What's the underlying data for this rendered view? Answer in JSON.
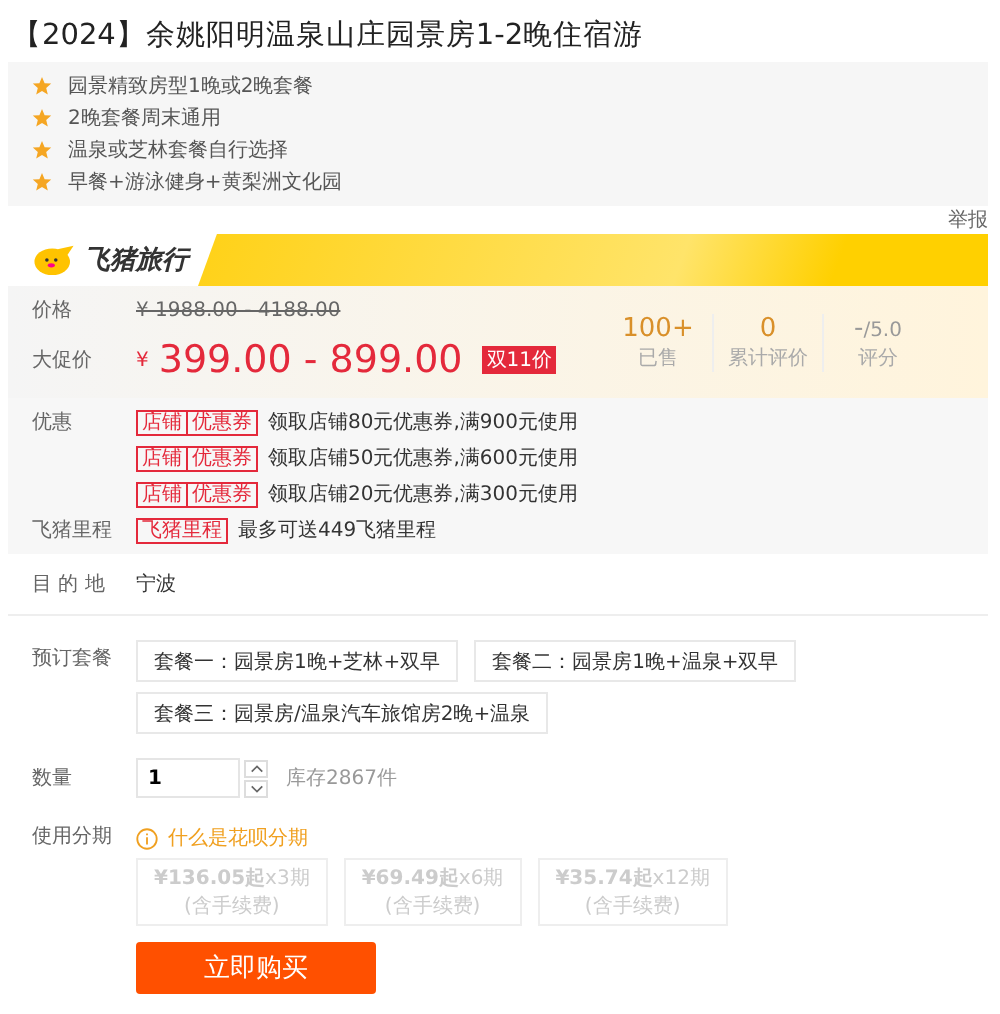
{
  "title": "【2024】余姚阳明温泉山庄园景房1-2晚住宿游",
  "features": [
    "园景精致房型1晚或2晚套餐",
    "2晚套餐周末通用",
    "温泉或芝林套餐自行选择",
    "早餐+游泳健身+黄梨洲文化园"
  ],
  "report_link": "举报",
  "brand": {
    "name": "飞猪旅行"
  },
  "price": {
    "label": "价格",
    "original": "¥ 1988.00 - 4188.00",
    "promo_label": "大促价",
    "currency": "¥",
    "promo": "399.00 - 899.00",
    "badge": "双11价"
  },
  "stats": [
    {
      "value": "100+",
      "label": "已售"
    },
    {
      "value": "0",
      "label": "累计评价"
    },
    {
      "value": "-",
      "suffix": "/5.0",
      "label": "评分"
    }
  ],
  "coupons": {
    "label": "优惠",
    "items": [
      {
        "tag": [
          "店铺",
          "优惠券"
        ],
        "text": "领取店铺80元优惠券,满900元使用"
      },
      {
        "tag": [
          "店铺",
          "优惠券"
        ],
        "text": "领取店铺50元优惠券,满600元使用"
      },
      {
        "tag": [
          "店铺",
          "优惠券"
        ],
        "text": "领取店铺20元优惠券,满300元使用"
      }
    ]
  },
  "mileage": {
    "label": "飞猪里程",
    "tag": "飞猪里程",
    "text": "最多可送449飞猪里程"
  },
  "destination": {
    "label": "目 的 地",
    "value": "宁波"
  },
  "packages": {
    "label": "预订套餐",
    "options": [
      {
        "text": "套餐一：园景房1晚+芝林+双早",
        "selected": false
      },
      {
        "text": "套餐二：园景房1晚+温泉+双早",
        "selected": false
      },
      {
        "text": "套餐三：园景房/温泉汽车旅馆房2晚+温泉",
        "selected": false
      }
    ]
  },
  "quantity": {
    "label": "数量",
    "value": "1",
    "stock": "库存2867件"
  },
  "installments": {
    "label": "使用分期",
    "help": "什么是花呗分期",
    "options": [
      {
        "amount": "**¥136.05起**x3期",
        "note": "(含手续费)",
        "disabled": true
      },
      {
        "amount": "**¥69.49起**x6期",
        "note": "(含手续费)",
        "disabled": true
      },
      {
        "amount": "**¥35.74起**x12期",
        "note": "(含手续费)",
        "disabled": true
      }
    ]
  },
  "buy_button": "立即购买"
}
